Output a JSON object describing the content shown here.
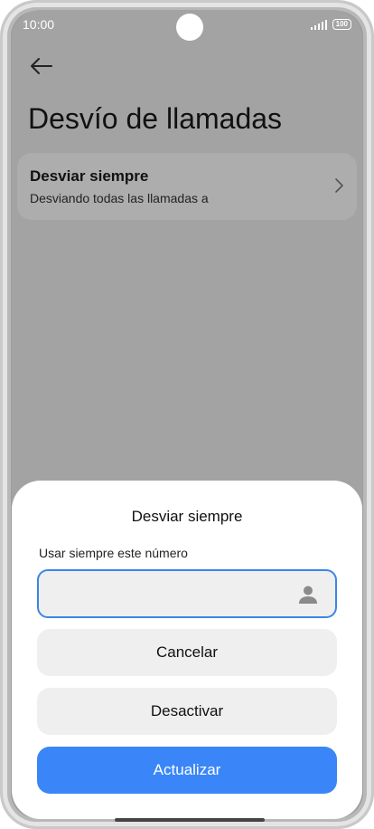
{
  "status_bar": {
    "time": "10:00",
    "battery": "100"
  },
  "page": {
    "title": "Desvío de llamadas"
  },
  "forward_item": {
    "title": "Desviar siempre",
    "subtitle": "Desviando todas las llamadas a"
  },
  "dialog": {
    "title": "Desviar siempre",
    "field_label": "Usar siempre este número",
    "input_value": "",
    "cancel_label": "Cancelar",
    "deactivate_label": "Desactivar",
    "update_label": "Actualizar"
  },
  "colors": {
    "accent": "#3a86f8",
    "input_border": "#3b86e6"
  },
  "icons": {
    "back": "arrow-left-icon",
    "chevron": "chevron-right-icon",
    "contact": "person-icon"
  }
}
